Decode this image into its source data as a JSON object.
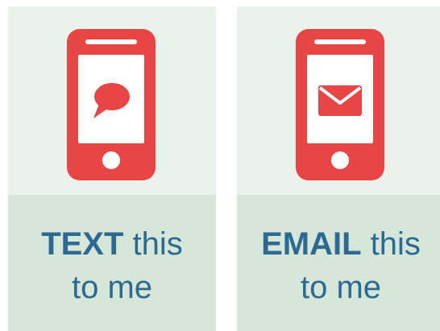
{
  "colors": {
    "accent_red": "#e84646",
    "text_blue": "#2d6a92",
    "card_top_bg": "#eaf2ec",
    "card_bottom_bg": "#d6e7da"
  },
  "cards": [
    {
      "icon": "phone-message-icon",
      "label_strong": "TEXT",
      "label_rest": "this",
      "label_line2": "to me"
    },
    {
      "icon": "phone-email-icon",
      "label_strong": "EMAIL",
      "label_rest": "this",
      "label_line2": "to me"
    }
  ]
}
